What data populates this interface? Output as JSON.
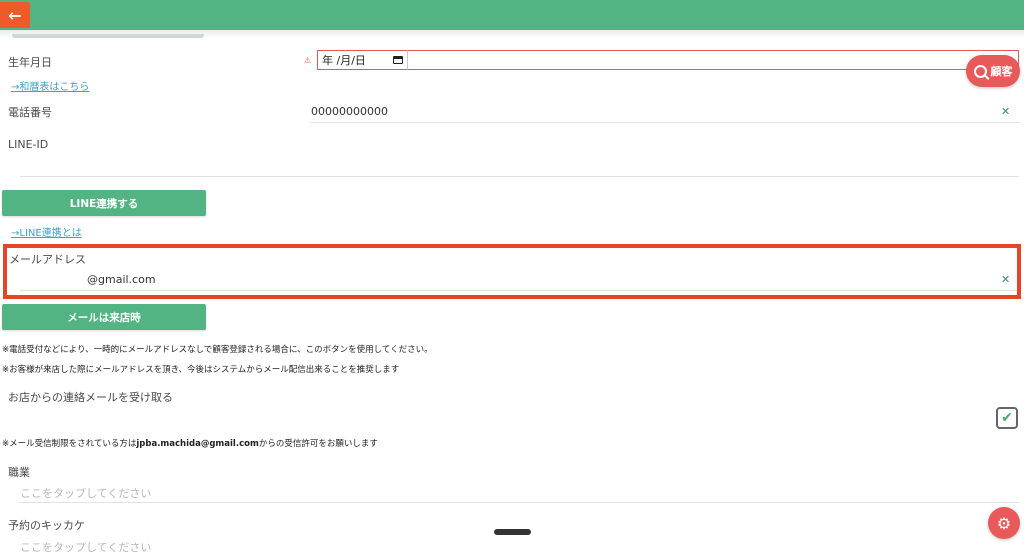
{
  "header": {
    "back_icon": "←"
  },
  "birthday": {
    "label": "生年月日",
    "warn_icon": "⚠",
    "date_placeholder": "年 /月/日",
    "link": "→和暦表はこちら"
  },
  "search_fab": {
    "label": "顧客"
  },
  "phone": {
    "label": "電話番号",
    "value": "00000000000",
    "clear_icon": "✕"
  },
  "line_id": {
    "label": "LINE-ID",
    "button": "LINE連携する",
    "link": "→LINE連携とは"
  },
  "email": {
    "label": "メールアドレス",
    "value": "@gmail.com",
    "clear_icon": "✕",
    "button": "メールは来店時"
  },
  "notes": {
    "note1": "※電話受付などにより、一時的にメールアドレスなしで顧客登録される場合に、このボタンを使用してください。",
    "note2": "※お客様が来店した際にメールアドレスを頂き、今後はシステムからメール配信出来ることを推奨します"
  },
  "receive_mail": {
    "label": "お店からの連絡メールを受け取る",
    "checked_icon": "✔"
  },
  "permission_note": {
    "prefix": "※メール受信制限をされている方は",
    "email": "jpba.machida@gmail.com",
    "suffix": "からの受信許可をお願いします"
  },
  "occupation": {
    "label": "職業",
    "placeholder": "ここをタップしてください"
  },
  "reservation_trigger": {
    "label": "予約のキッカケ",
    "placeholder": "ここをタップしてください"
  },
  "settings_fab": {
    "icon": "⚙"
  }
}
